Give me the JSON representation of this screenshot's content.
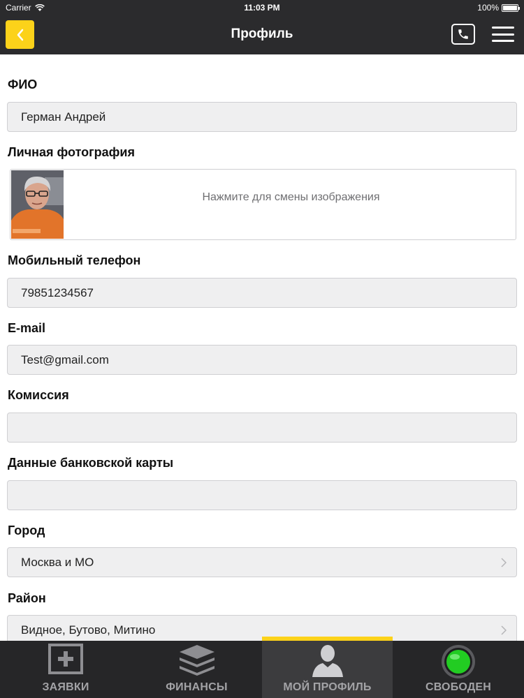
{
  "status_bar": {
    "carrier": "Carrier",
    "time": "11:03 PM",
    "battery": "100%",
    "wifi_icon": "wifi-icon",
    "battery_icon": "battery-icon"
  },
  "nav": {
    "title": "Профиль",
    "back_icon": "chevron-left-icon",
    "phone_icon": "phone-icon",
    "menu_icon": "hamburger-menu-icon"
  },
  "form": {
    "name": {
      "label": "ФИО",
      "value": "Герман Андрей"
    },
    "photo": {
      "label": "Личная фотография",
      "hint": "Нажмите для смены изображения"
    },
    "phone": {
      "label": "Мобильный телефон",
      "value": "79851234567"
    },
    "email": {
      "label": "E-mail",
      "value": "Test@gmail.com"
    },
    "commission": {
      "label": "Комиссия",
      "value": ""
    },
    "card": {
      "label": "Данные банковской карты",
      "value": ""
    },
    "city": {
      "label": "Город",
      "value": "Москва и МО"
    },
    "district": {
      "label": "Район",
      "value": "Видное, Бутово, Митино"
    }
  },
  "tabs": [
    {
      "label": "ЗАЯВКИ",
      "icon": "add-request-icon",
      "active": false
    },
    {
      "label": "ФИНАНСЫ",
      "icon": "layers-icon",
      "active": false
    },
    {
      "label": "МОЙ ПРОФИЛЬ",
      "icon": "person-icon",
      "active": true
    },
    {
      "label": "СВОБОДЕН",
      "icon": "status-online-icon",
      "active": false
    }
  ],
  "colors": {
    "accent": "#fcd21a",
    "bar_background": "#2b2b2d",
    "tab_background": "#262628",
    "field_background": "#efeff0",
    "status_online": "#22cc22"
  }
}
